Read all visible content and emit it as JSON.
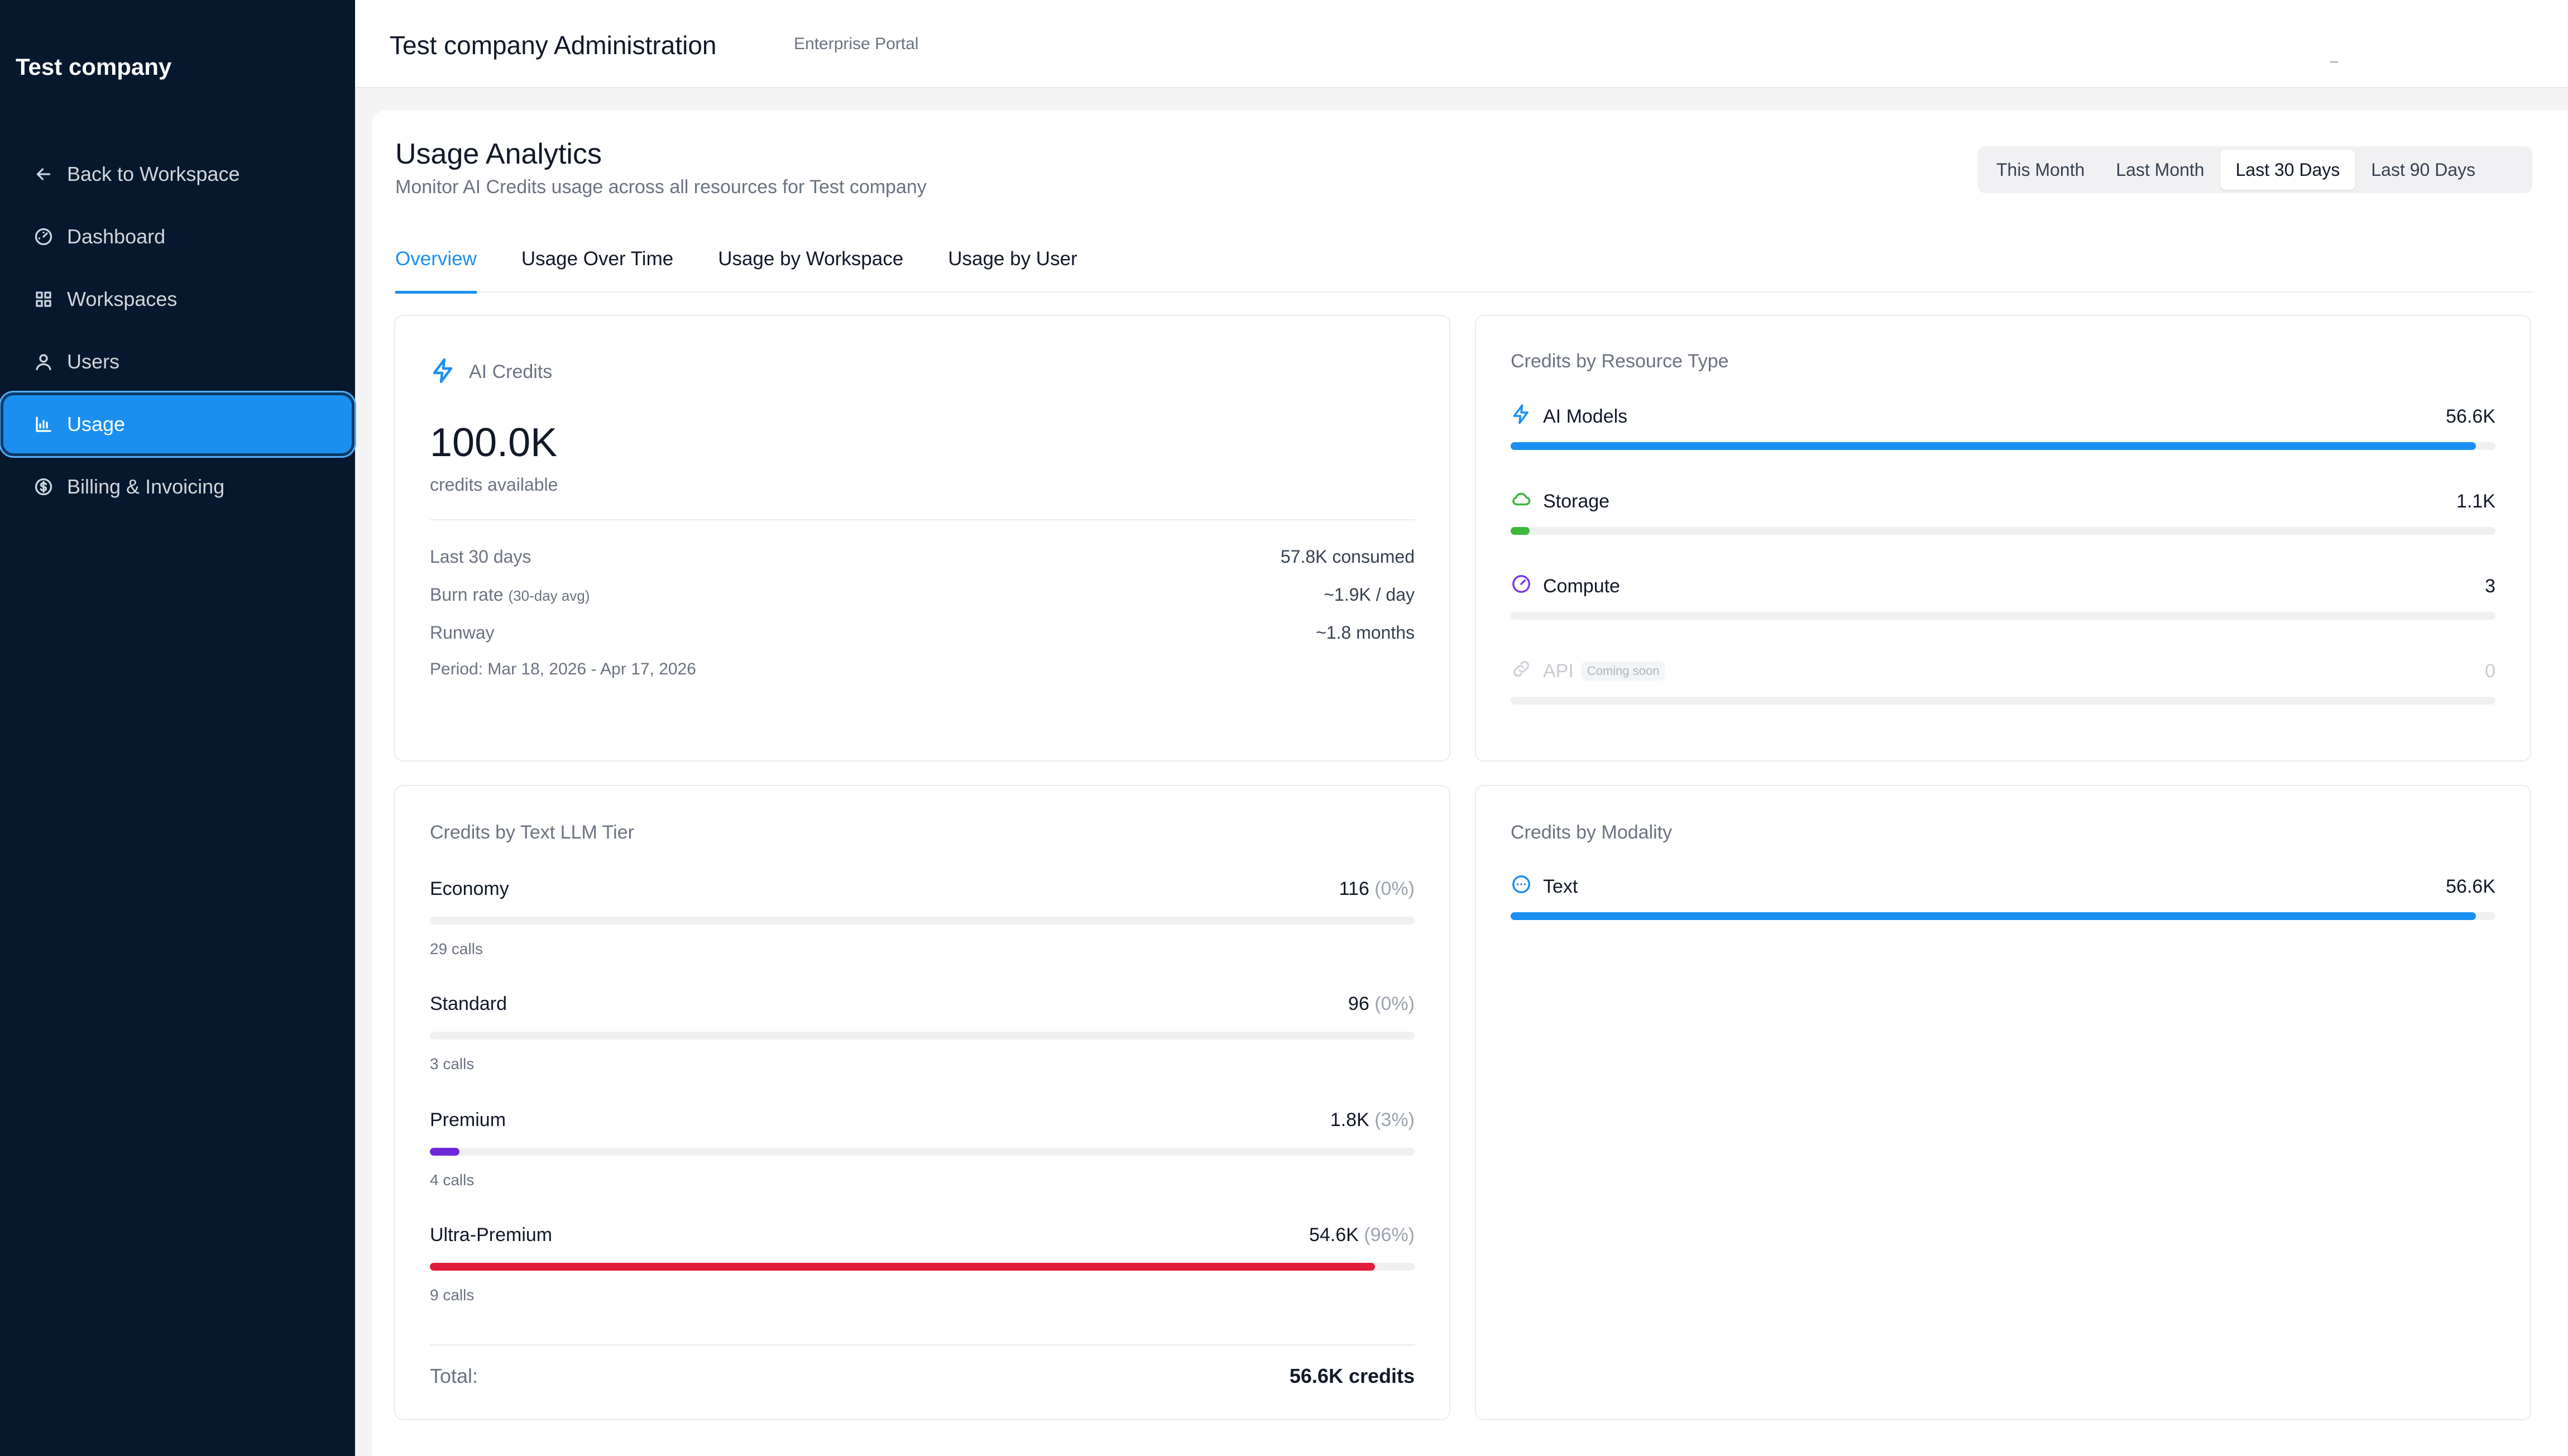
{
  "sidebar": {
    "brand": "Test company",
    "items": [
      {
        "label": "Back to Workspace",
        "icon": "arrow-left-icon"
      },
      {
        "label": "Dashboard",
        "icon": "gauge-icon"
      },
      {
        "label": "Workspaces",
        "icon": "grid-icon"
      },
      {
        "label": "Users",
        "icon": "user-icon"
      },
      {
        "label": "Usage",
        "icon": "bar-chart-icon",
        "active": true
      },
      {
        "label": "Billing & Invoicing",
        "icon": "dollar-circle-icon"
      }
    ]
  },
  "header": {
    "title": "Test company Administration",
    "subtitle": "Enterprise Portal"
  },
  "page": {
    "title": "Usage Analytics",
    "subtitle": "Monitor AI Credits usage across all resources for Test company"
  },
  "range": {
    "options": [
      "This Month",
      "Last Month",
      "Last 30 Days",
      "Last 90 Days"
    ],
    "selected": "Last 30 Days"
  },
  "tabs": [
    "Overview",
    "Usage Over Time",
    "Usage by Workspace",
    "Usage by User"
  ],
  "credits": {
    "title": "AI Credits",
    "amount": "100.0K",
    "amount_label": "credits available",
    "rows": [
      {
        "label": "Last 30 days",
        "note": "",
        "value": "57.8K consumed"
      },
      {
        "label": "Burn rate",
        "note": "(30-day avg)",
        "value": "~1.9K / day"
      },
      {
        "label": "Runway",
        "note": "",
        "value": "~1.8 months"
      }
    ],
    "period": "Period: Mar 18, 2026 - Apr 17, 2026"
  },
  "resource": {
    "title": "Credits by Resource Type",
    "rows": [
      {
        "name": "AI Models",
        "value": "56.6K",
        "fraction": 0.98,
        "color": "#1b8ff0",
        "icon": "lightning-icon"
      },
      {
        "name": "Storage",
        "value": "1.1K",
        "fraction": 0.019,
        "color": "#3cb83a",
        "icon": "cloud-icon"
      },
      {
        "name": "Compute",
        "value": "3",
        "fraction": 0.0,
        "color": "#7c3aed",
        "icon": "gauge-icon"
      },
      {
        "name": "API",
        "badge": "Coming soon",
        "value": "0",
        "fraction": 0.0,
        "color": "#d1d5db",
        "icon": "link-icon",
        "disabled": true
      }
    ]
  },
  "tiers": {
    "title": "Credits by Text LLM Tier",
    "rows": [
      {
        "name": "Economy",
        "value": "116",
        "pct": "(0%)",
        "calls": "29 calls",
        "fraction": 0.0,
        "color": "#9ca3af"
      },
      {
        "name": "Standard",
        "value": "96",
        "pct": "(0%)",
        "calls": "3 calls",
        "fraction": 0.0,
        "color": "#9ca3af"
      },
      {
        "name": "Premium",
        "value": "1.8K",
        "pct": "(3%)",
        "calls": "4 calls",
        "fraction": 0.03,
        "color": "#6d28d9"
      },
      {
        "name": "Ultra-Premium",
        "value": "54.6K",
        "pct": "(96%)",
        "calls": "9 calls",
        "fraction": 0.96,
        "color": "#e11d3a"
      }
    ],
    "total_label": "Total:",
    "total_value": "56.6K credits"
  },
  "modality": {
    "title": "Credits by Modality",
    "rows": [
      {
        "name": "Text",
        "value": "56.6K",
        "fraction": 0.98,
        "color": "#1b8ff0",
        "icon": "chat-bubble-icon"
      }
    ]
  }
}
